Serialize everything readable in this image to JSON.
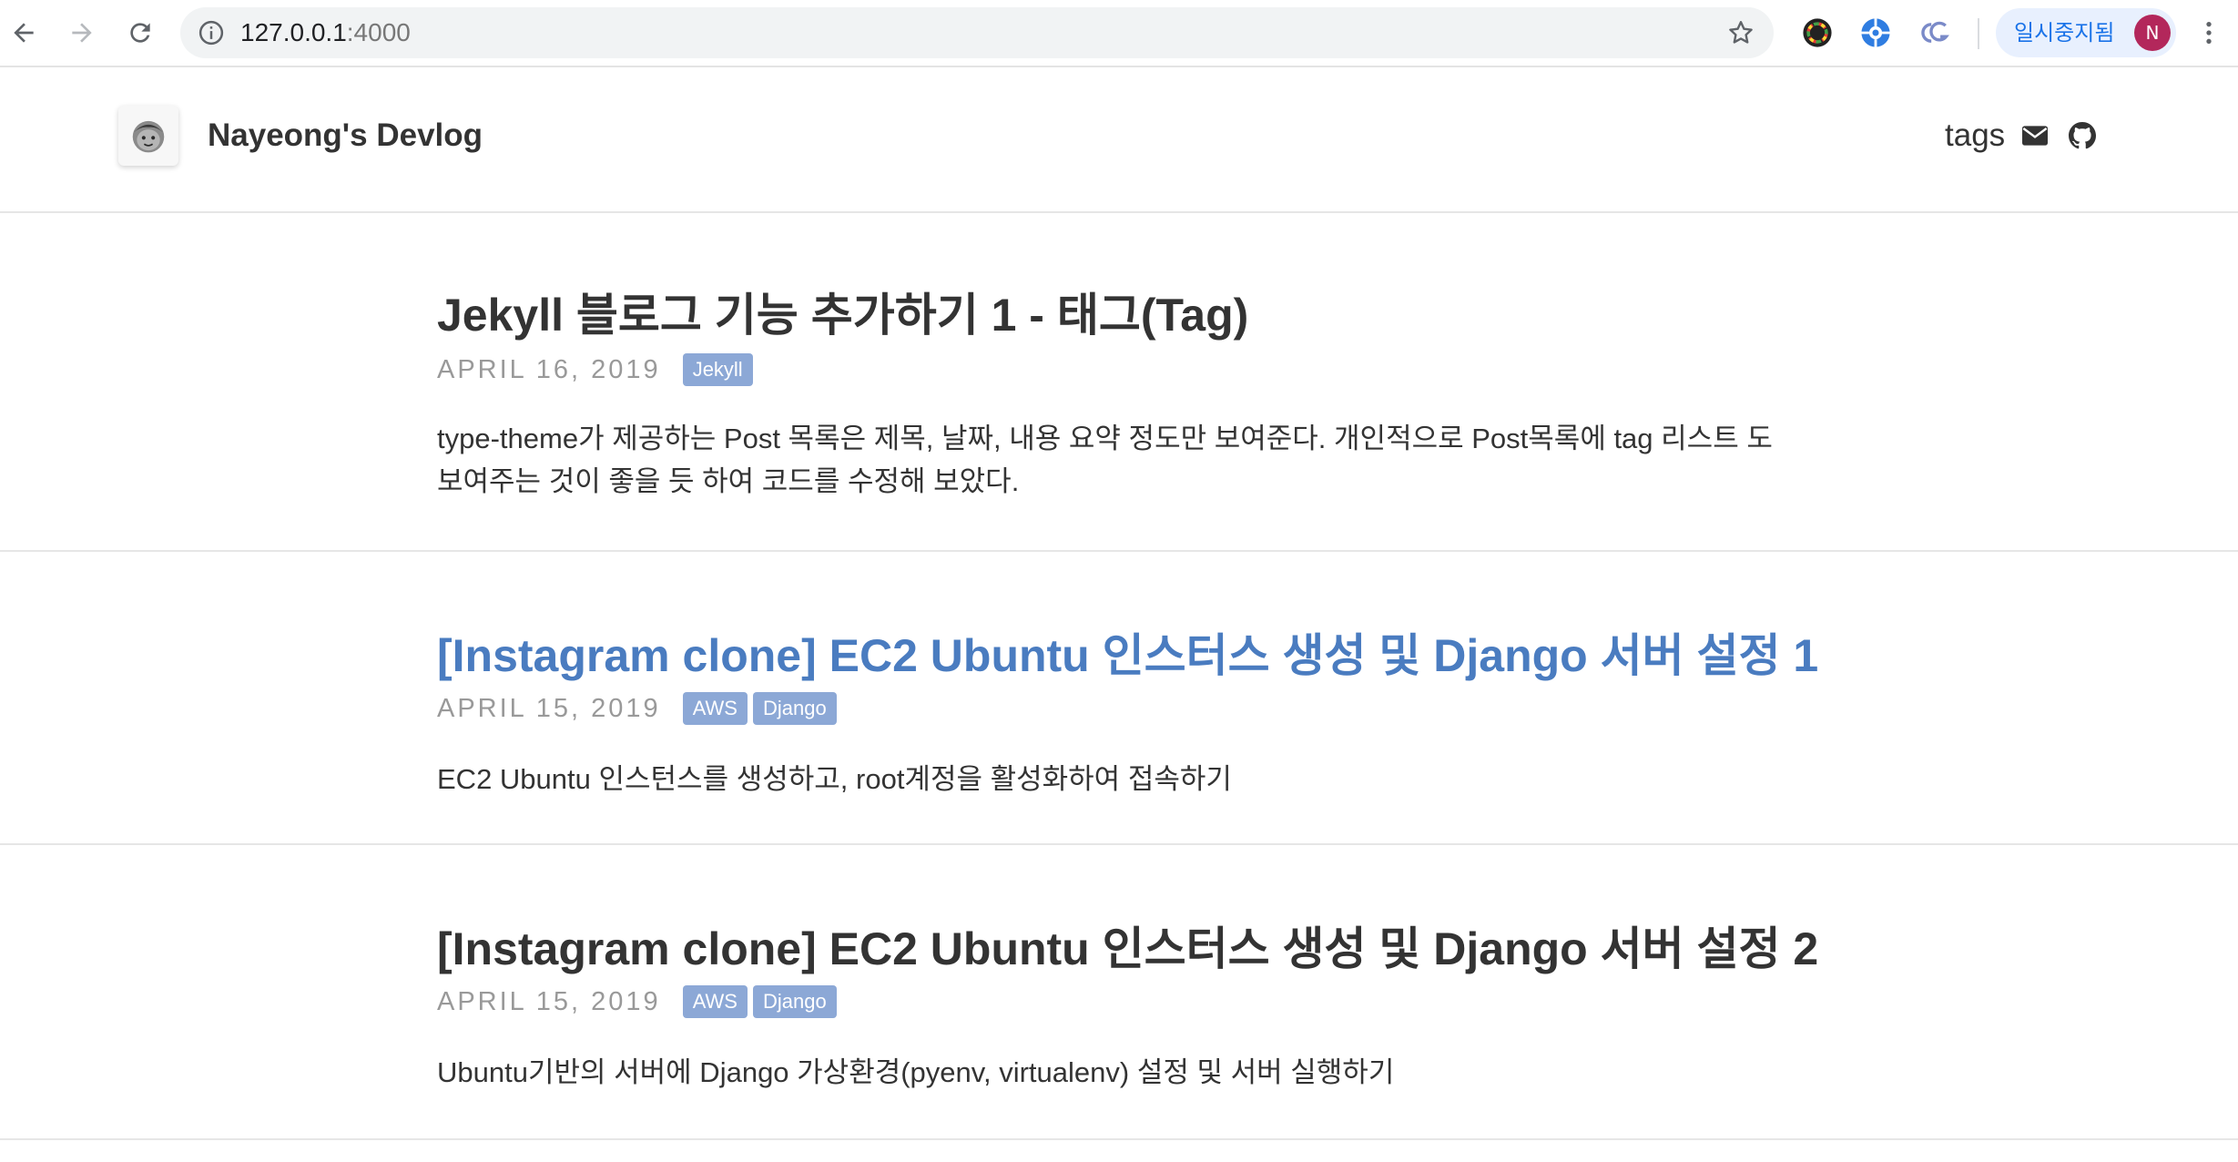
{
  "browser": {
    "url_host": "127.0.0.1",
    "url_port": ":4000",
    "profile_label": "일시중지됨",
    "profile_initial": "N",
    "icons": [
      "back-arrow-icon",
      "forward-arrow-icon",
      "reload-icon",
      "info-icon",
      "star-icon",
      "color-picker-extension-icon",
      "blue-extension-icon",
      "cg-extension-icon",
      "more-vert-icon"
    ]
  },
  "site": {
    "title": "Nayeong's Devlog",
    "nav": {
      "tags_label": "tags"
    },
    "nav_icons": [
      "envelope-icon",
      "github-icon"
    ]
  },
  "posts": [
    {
      "title": "Jekyll 블로그 기능 추가하기 1 - 태그(Tag)",
      "date": "APRIL 16, 2019",
      "tags": [
        "Jekyll"
      ],
      "excerpt": "type-theme가 제공하는 Post 목록은 제목, 날짜, 내용 요약 정도만 보여준다. 개인적으로 Post목록에 tag 리스트 도 보여주는 것이 좋을 듯 하여 코드를 수정해 보았다."
    },
    {
      "title": "[Instagram clone] EC2 Ubuntu 인스터스 생성 및 Django 서버 설정 1",
      "date": "APRIL 15, 2019",
      "tags": [
        "AWS",
        "Django"
      ],
      "excerpt": "EC2 Ubuntu 인스턴스를 생성하고, root계정을 활성화하여 접속하기"
    },
    {
      "title": "[Instagram clone] EC2 Ubuntu 인스터스 생성 및 Django 서버 설정 2",
      "date": "APRIL 15, 2019",
      "tags": [
        "AWS",
        "Django"
      ],
      "excerpt": "Ubuntu기반의 서버에 Django 가상환경(pyenv, virtualenv) 설정 및 서버 실행하기"
    }
  ],
  "colors": {
    "link_hover": "#4a7cc0",
    "tag_bg": "#8ca8d6",
    "date_text": "#999999",
    "profile_pill_bg": "#e8f0fe",
    "profile_avatar_bg": "#b3275b"
  }
}
